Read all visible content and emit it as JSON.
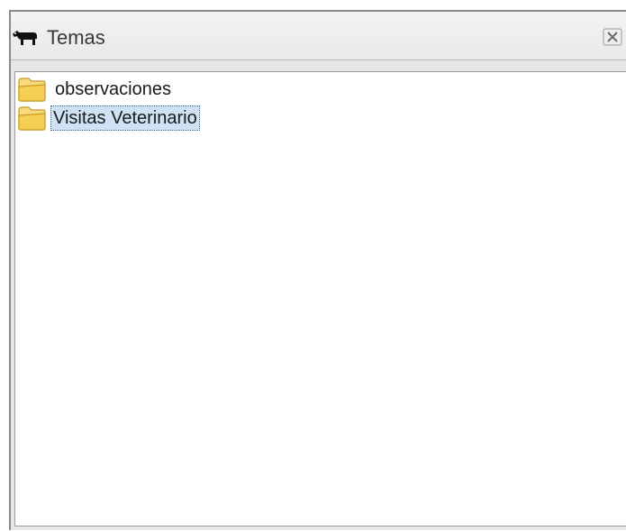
{
  "panel": {
    "title": "Temas",
    "title_icon": "cow-icon",
    "close_icon": "close-icon"
  },
  "tree": {
    "items": [
      {
        "label": "observaciones",
        "icon": "folder-icon",
        "selected": false
      },
      {
        "label": "Visitas Veterinario",
        "icon": "folder-icon",
        "selected": true
      }
    ]
  },
  "colors": {
    "selection_bg": "#cfe1f5",
    "folder_fill": "#f5d46a",
    "folder_stroke": "#c99a23"
  }
}
